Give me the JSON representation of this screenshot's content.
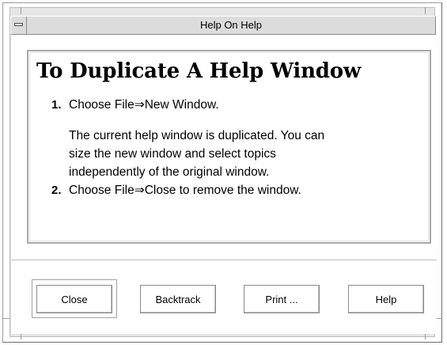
{
  "window": {
    "title": "Help On Help"
  },
  "content": {
    "heading": "To Duplicate A Help Window",
    "steps": [
      {
        "number": "1.",
        "text": "Choose File⇒New Window.",
        "description_lines": [
          "The current help window is duplicated. You can",
          "size the new window and select topics",
          "independently of the original window."
        ]
      },
      {
        "number": "2.",
        "text": "Choose File⇒Close to remove the window."
      }
    ]
  },
  "buttons": {
    "close": "Close",
    "backtrack": "Backtrack",
    "print": "Print ...",
    "help": "Help"
  },
  "icons": {
    "window_menu": "window-menu-icon"
  }
}
